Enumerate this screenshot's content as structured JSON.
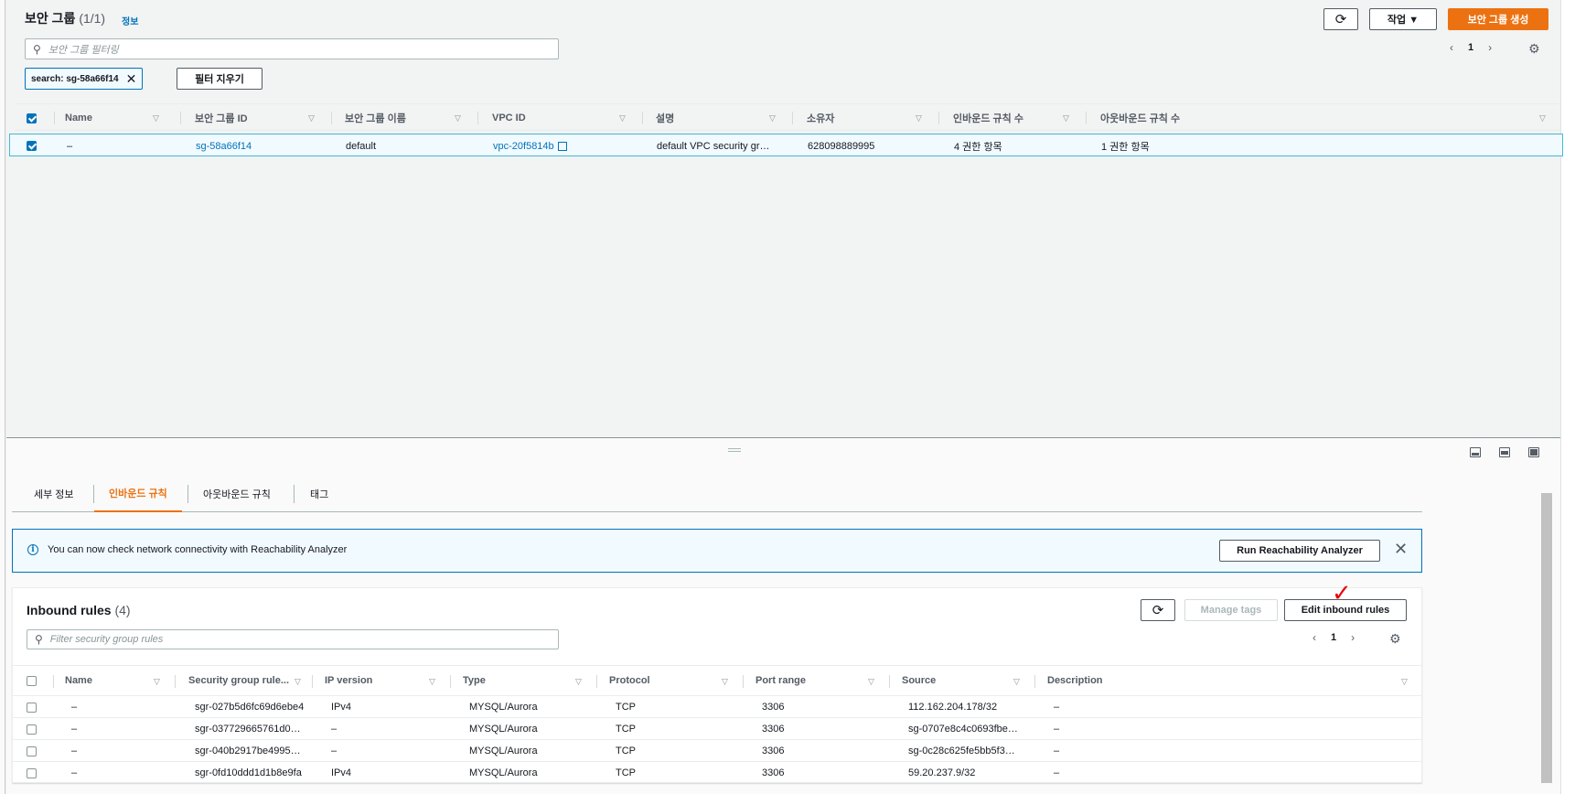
{
  "top": {
    "title": "보안 그룹",
    "count": "(1/1)",
    "info_link": "정보",
    "refresh_icon": "refresh-icon",
    "actions_label": "작업 ▼",
    "create_label": "보안 그룹 생성",
    "filter_placeholder": "보안 그룹 필터링",
    "token_label": "search: sg-58a66f14",
    "clear_filters_label": "필터 지우기",
    "page_number": "1",
    "columns": [
      "Name",
      "보안 그룹 ID",
      "보안 그룹 이름",
      "VPC ID",
      "설명",
      "소유자",
      "인바운드 규칙 수",
      "아웃바운드 규칙 수"
    ],
    "row": {
      "name": "–",
      "group_id": "sg-58a66f14",
      "group_name": "default",
      "vpc_id": "vpc-20f5814b",
      "description": "default VPC security gr…",
      "owner": "628098889995",
      "inbound": "4 권한 항목",
      "outbound": "1 권한 항목"
    }
  },
  "tabs": [
    "세부 정보",
    "인바운드 규칙",
    "아웃바운드 규칙",
    "태그"
  ],
  "active_tab": "인바운드 규칙",
  "banner": {
    "message": "You can now check network connectivity with Reachability Analyzer",
    "button_label": "Run Reachability Analyzer"
  },
  "inbound": {
    "title": "Inbound rules",
    "count": "(4)",
    "manage_tags_label": "Manage tags",
    "edit_label": "Edit inbound rules",
    "filter_placeholder": "Filter security group rules",
    "page_number": "1",
    "columns": [
      "Name",
      "Security group rule...",
      "IP version",
      "Type",
      "Protocol",
      "Port range",
      "Source",
      "Description"
    ],
    "rows": [
      {
        "name": "–",
        "rule_id": "sgr-027b5d6fc69d6ebe4",
        "ip_version": "IPv4",
        "type": "MYSQL/Aurora",
        "protocol": "TCP",
        "port": "3306",
        "source": "112.162.204.178/32",
        "description": "–"
      },
      {
        "name": "–",
        "rule_id": "sgr-037729665761d0…",
        "ip_version": "–",
        "type": "MYSQL/Aurora",
        "protocol": "TCP",
        "port": "3306",
        "source": "sg-0707e8c4c0693fbe…",
        "description": "–"
      },
      {
        "name": "–",
        "rule_id": "sgr-040b2917be4995…",
        "ip_version": "–",
        "type": "MYSQL/Aurora",
        "protocol": "TCP",
        "port": "3306",
        "source": "sg-0c28c625fe5bb5f3…",
        "description": "–"
      },
      {
        "name": "–",
        "rule_id": "sgr-0fd10ddd1d1b8e9fa",
        "ip_version": "IPv4",
        "type": "MYSQL/Aurora",
        "protocol": "TCP",
        "port": "3306",
        "source": "59.20.237.9/32",
        "description": "–"
      }
    ]
  },
  "annotation_mark": "✓",
  "colors": {
    "accent": "#ec7211",
    "link": "#0073bb",
    "selected_border": "#44b9d6"
  }
}
